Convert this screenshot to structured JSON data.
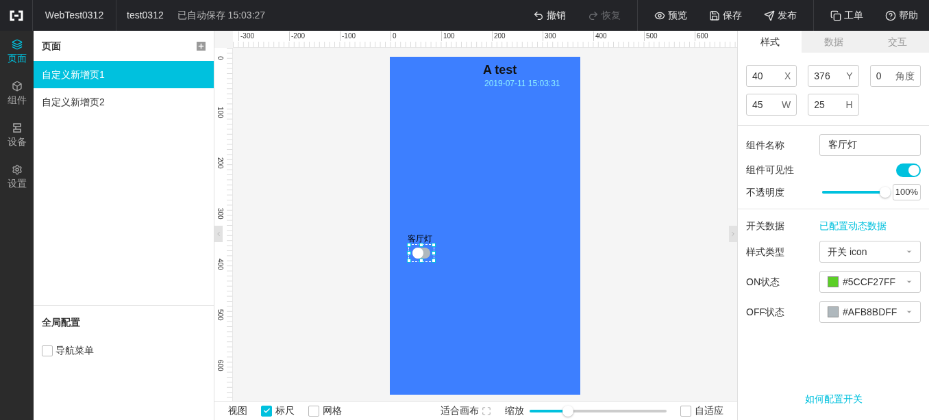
{
  "app": {
    "project": "WebTest0312",
    "page_name": "test0312",
    "autosave": "已自动保存 15:03:27"
  },
  "toolbar": [
    {
      "label": "撤销",
      "kind": "undo",
      "disabled": false
    },
    {
      "label": "恢复",
      "kind": "redo",
      "disabled": true
    },
    {
      "label": "预览",
      "kind": "preview",
      "disabled": false
    },
    {
      "label": "保存",
      "kind": "save",
      "disabled": false
    },
    {
      "label": "发布",
      "kind": "publish",
      "disabled": false
    },
    {
      "label": "工单",
      "kind": "ticket",
      "disabled": false
    },
    {
      "label": "帮助",
      "kind": "help",
      "disabled": false
    }
  ],
  "nav": [
    {
      "label": "页面",
      "kind": "pages",
      "selected": true
    },
    {
      "label": "组件",
      "kind": "components",
      "selected": false
    },
    {
      "label": "设备",
      "kind": "devices",
      "selected": false
    },
    {
      "label": "设置",
      "kind": "settings",
      "selected": false
    }
  ],
  "pages_panel": {
    "title": "页面",
    "items": [
      {
        "label": "自定义新增页1",
        "selected": true
      },
      {
        "label": "自定义新增页2",
        "selected": false
      }
    ]
  },
  "global_config": {
    "title": "全局配置",
    "options": [
      {
        "label": "导航菜单",
        "checked": false
      }
    ]
  },
  "ruler": {
    "horizontal": [
      "-300",
      "-200",
      "-100",
      "0",
      "100",
      "200",
      "300",
      "400",
      "500",
      "600"
    ],
    "vertical": [
      "0",
      "100",
      "200",
      "300",
      "400",
      "500",
      "600"
    ]
  },
  "canvas": {
    "title": "A test",
    "timestamp": "2019-07-11 15:03:31",
    "widget": {
      "label": "客厅灯",
      "on": false
    }
  },
  "bottom_bar": {
    "view_label": "视图",
    "options": [
      {
        "label": "标尺",
        "checked": true
      },
      {
        "label": "网格",
        "checked": false
      }
    ],
    "fit_label": "适合画布",
    "zoom_label": "缩放",
    "zoom": {
      "level": 0.26
    },
    "auto_fit": {
      "label": "自适应",
      "checked": false
    }
  },
  "inspector": {
    "tabs": [
      {
        "label": "样式",
        "selected": true
      },
      {
        "label": "数据",
        "selected": false
      },
      {
        "label": "交互",
        "selected": false
      }
    ],
    "geometry": [
      {
        "value": "40",
        "unit": "X"
      },
      {
        "value": "376",
        "unit": "Y"
      },
      {
        "value": "0",
        "unit": "角度"
      },
      {
        "value": "45",
        "unit": "W"
      },
      {
        "value": "25",
        "unit": "H"
      }
    ],
    "name_label": "组件名称",
    "name_value": "客厅灯",
    "visibility_label": "组件可见性",
    "visible": true,
    "opacity_label": "不透明度",
    "opacity": {
      "level": 1
    },
    "opacity_value": "100%",
    "data_label": "开关数据",
    "data_link": "已配置动态数据",
    "style_label": "样式类型",
    "style_value": "开关 icon",
    "states": [
      {
        "label": "ON状态",
        "value": "#5CCF27FF",
        "color": "#5ccf27"
      },
      {
        "label": "OFF状态",
        "value": "#AFB8BDFF",
        "color": "#afb8bd"
      }
    ],
    "help_link": "如何配置开关"
  }
}
